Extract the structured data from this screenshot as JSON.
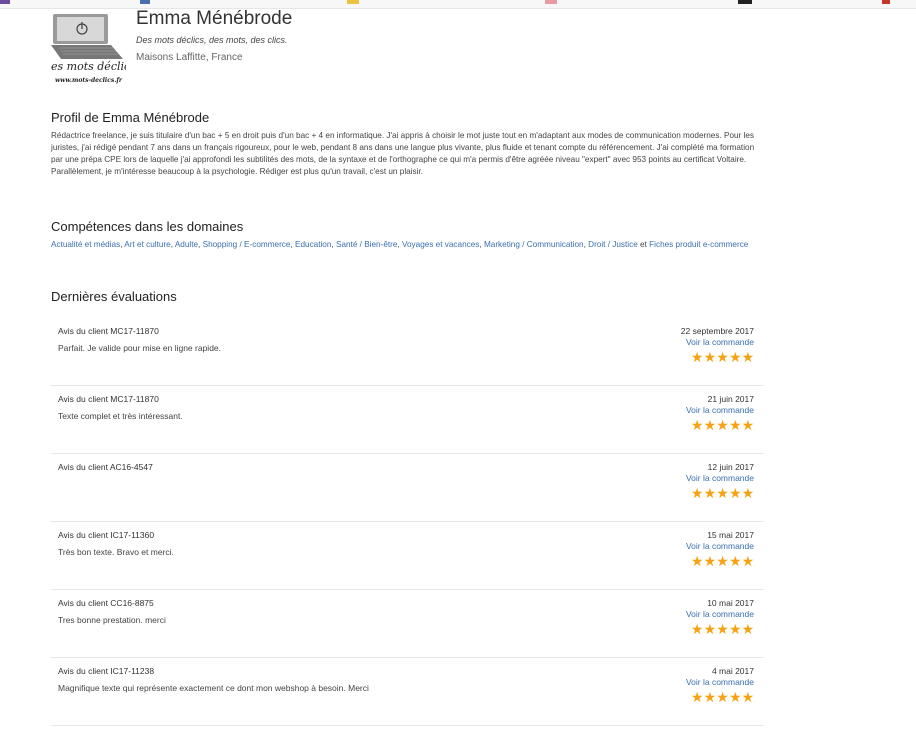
{
  "colors": {
    "accent_link": "#3a6fb0",
    "star": "#f5a312"
  },
  "profile": {
    "name": "Emma Ménébrode",
    "tagline": "Des mots déclics, des mots, des clics.",
    "location": "Maisons Laffitte, France",
    "logo": {
      "icon": "power-icon",
      "text_main": "es mots déclic",
      "text_url": "www.mots-declics.fr"
    }
  },
  "about": {
    "title": "Profil de Emma Ménébrode",
    "text": "Rédactrice freelance, je suis titulaire d'un bac + 5 en droit puis d'un bac + 4 en informatique. J'ai appris à choisir le mot juste tout en m'adaptant aux modes de communication modernes. Pour les juristes, j'ai rédigé pendant 7 ans dans un français rigoureux, pour le web, pendant 8 ans dans une langue plus vivante, plus fluide et tenant compte du référencement. J'ai complété ma formation par une prépa CPE lors de laquelle j'ai approfondi les subtilités des mots, de la syntaxe et de l'orthographe ce qui m'a permis d'être agréée niveau \"expert\" avec 953 points au certificat Voltaire. Parallèlement, je m'intéresse beaucoup à la psychologie. Rédiger est plus qu'un travail, c'est un plaisir."
  },
  "skills": {
    "title": "Compétences dans les domaines",
    "items": [
      "Actualité et médias",
      "Art et culture",
      "Adulte",
      "Shopping / E-commerce",
      "Education",
      "Santé / Bien-être",
      "Voyages et vacances",
      "Marketing / Communication",
      "Droit / Justice",
      "Fiches produit e-commerce"
    ],
    "separator": ", ",
    "last_separator": " et "
  },
  "reviews": {
    "title": "Dernières évaluations",
    "link_label": "Voir la commande",
    "items": [
      {
        "client": "Avis du client MC17-11870",
        "date": "22 septembre 2017",
        "text": "Parfait. Je valide pour mise en ligne rapide.",
        "rating": 5
      },
      {
        "client": "Avis du client MC17-11870",
        "date": "21 juin 2017",
        "text": "Texte complet et très intéressant.",
        "rating": 5
      },
      {
        "client": "Avis du client AC16-4547",
        "date": "12 juin 2017",
        "text": "",
        "rating": 5
      },
      {
        "client": "Avis du client IC17-11360",
        "date": "15 mai 2017",
        "text": "Très bon texte. Bravo et merci.",
        "rating": 5
      },
      {
        "client": "Avis du client CC16-8875",
        "date": "10 mai 2017",
        "text": "Tres bonne prestation. merci",
        "rating": 5
      },
      {
        "client": "Avis du client IC17-11238",
        "date": "4 mai 2017",
        "text": "Magnifique texte qui représente exactement ce dont mon webshop à besoin. Merci",
        "rating": 5
      }
    ]
  }
}
